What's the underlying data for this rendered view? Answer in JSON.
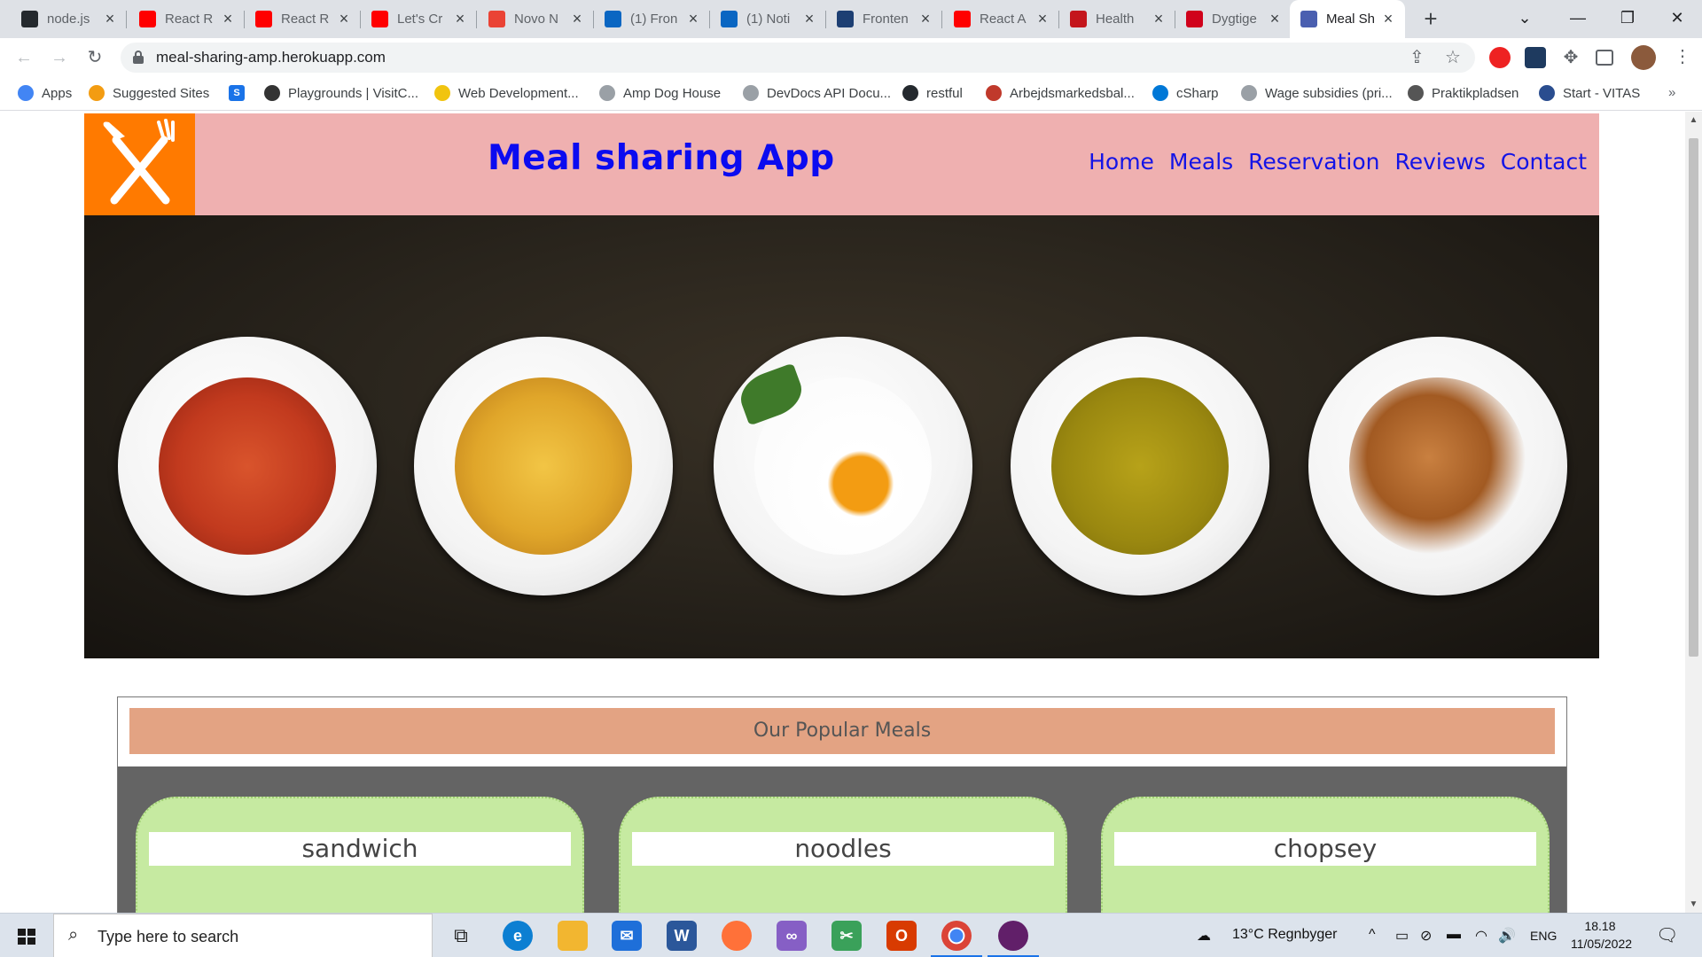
{
  "browser": {
    "tabs": [
      {
        "title": "node.js",
        "icon": "github-icon",
        "color": "#24292e"
      },
      {
        "title": "React R",
        "icon": "youtube-icon",
        "color": "#ff0000"
      },
      {
        "title": "React R",
        "icon": "youtube-icon",
        "color": "#ff0000"
      },
      {
        "title": "Let's Cr",
        "icon": "youtube-icon",
        "color": "#ff0000"
      },
      {
        "title": "Novo N",
        "icon": "gmail-icon",
        "color": "#ea4335"
      },
      {
        "title": "(1) Fron",
        "icon": "linkedin-icon",
        "color": "#0a66c2"
      },
      {
        "title": "(1) Noti",
        "icon": "linkedin-icon",
        "color": "#0a66c2"
      },
      {
        "title": "Fronten",
        "icon": "a-letter-icon",
        "color": "#1d3f73"
      },
      {
        "title": "React A",
        "icon": "youtube-icon",
        "color": "#ff0000"
      },
      {
        "title": "Health",
        "icon": "j-letter-icon",
        "color": "#c4161c"
      },
      {
        "title": "Dygtige",
        "icon": "heart-icon",
        "color": "#d0021b"
      },
      {
        "title": "Meal Sh",
        "icon": "globe-icon",
        "color": "#4a5fb0"
      }
    ],
    "url": "meal-sharing-amp.herokuapp.com",
    "bookmarks": [
      {
        "label": "Apps",
        "icon": "apps-grid-icon"
      },
      {
        "label": "Suggested Sites",
        "icon": "suggested-sites-icon"
      },
      {
        "label": "",
        "icon": "s-letter-icon"
      },
      {
        "label": "Playgrounds | VisitC...",
        "icon": "playground-icon"
      },
      {
        "label": "Web Development...",
        "icon": "web-dev-icon"
      },
      {
        "label": "Amp Dog House",
        "icon": "globe-icon"
      },
      {
        "label": "DevDocs API Docu...",
        "icon": "globe-icon"
      },
      {
        "label": "restful",
        "icon": "github-icon"
      },
      {
        "label": "Arbejdsmarkedsbal...",
        "icon": "flag-icon"
      },
      {
        "label": "cSharp",
        "icon": "windows-logo-icon"
      },
      {
        "label": "Wage subsidies (pri...",
        "icon": "globe-icon"
      },
      {
        "label": "Praktikpladsen",
        "icon": "crown-icon"
      },
      {
        "label": "Start - VITAS",
        "icon": "crown-icon"
      }
    ]
  },
  "site": {
    "title": "Meal sharing App",
    "nav": [
      "Home",
      "Meals",
      "Reservation",
      "Reviews",
      "Contact"
    ],
    "popular_heading": "Our Popular Meals",
    "meals": [
      "sandwich",
      "noodles",
      "chopsey"
    ],
    "colors": {
      "header_bg": "#efb0b0",
      "logo_bg": "#ff7a00",
      "title": "#0b0bf0",
      "popular_head_bg": "#e3a383",
      "card_bg": "#c6eaa1",
      "meals_area_bg": "#646464"
    }
  },
  "taskbar": {
    "search_placeholder": "Type here to search",
    "weather": "13°C  Regnbyger",
    "language": "ENG",
    "time": "18.18",
    "date": "11/05/2022"
  }
}
